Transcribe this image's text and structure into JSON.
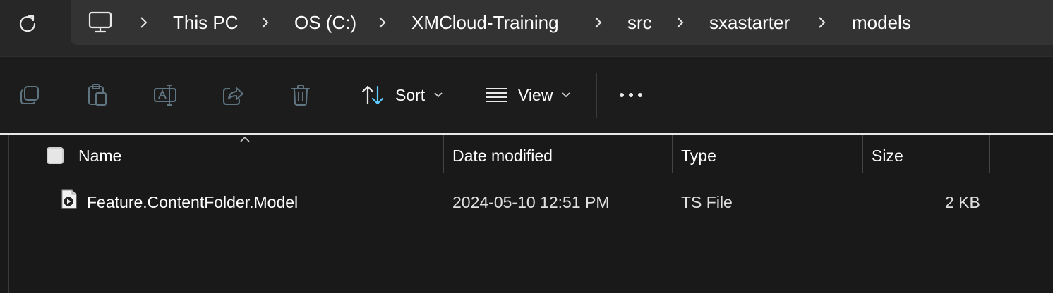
{
  "address_bar": {
    "icons": {
      "refresh": "refresh-icon",
      "root": "computer-icon",
      "separator": "chevron-right-icon"
    },
    "breadcrumbs": [
      "This PC",
      "OS (C:)",
      "XMCloud-Training",
      "src",
      "sxastarter",
      "models"
    ]
  },
  "toolbar": {
    "icons": [
      "copy-icon",
      "paste-icon",
      "rename-icon",
      "share-icon",
      "delete-icon"
    ],
    "sort_label": "Sort",
    "view_label": "View",
    "more_icon": "more-options-icon"
  },
  "file_list": {
    "columns": [
      "Name",
      "Date modified",
      "Type",
      "Size"
    ],
    "rows": [
      {
        "icon": "ts-file-icon",
        "name": "Feature.ContentFolder.Model",
        "date_modified": "2024-05-10 12:51 PM",
        "type": "TS File",
        "size": "2 KB"
      }
    ]
  },
  "colors": {
    "address_bar_bg": "#272727",
    "breadcrumb_bg": "#333333",
    "toolbar_bg": "#1c1c1c",
    "content_bg": "#191919",
    "disabled_icon": "#5f7682",
    "text": "#ffffff"
  }
}
